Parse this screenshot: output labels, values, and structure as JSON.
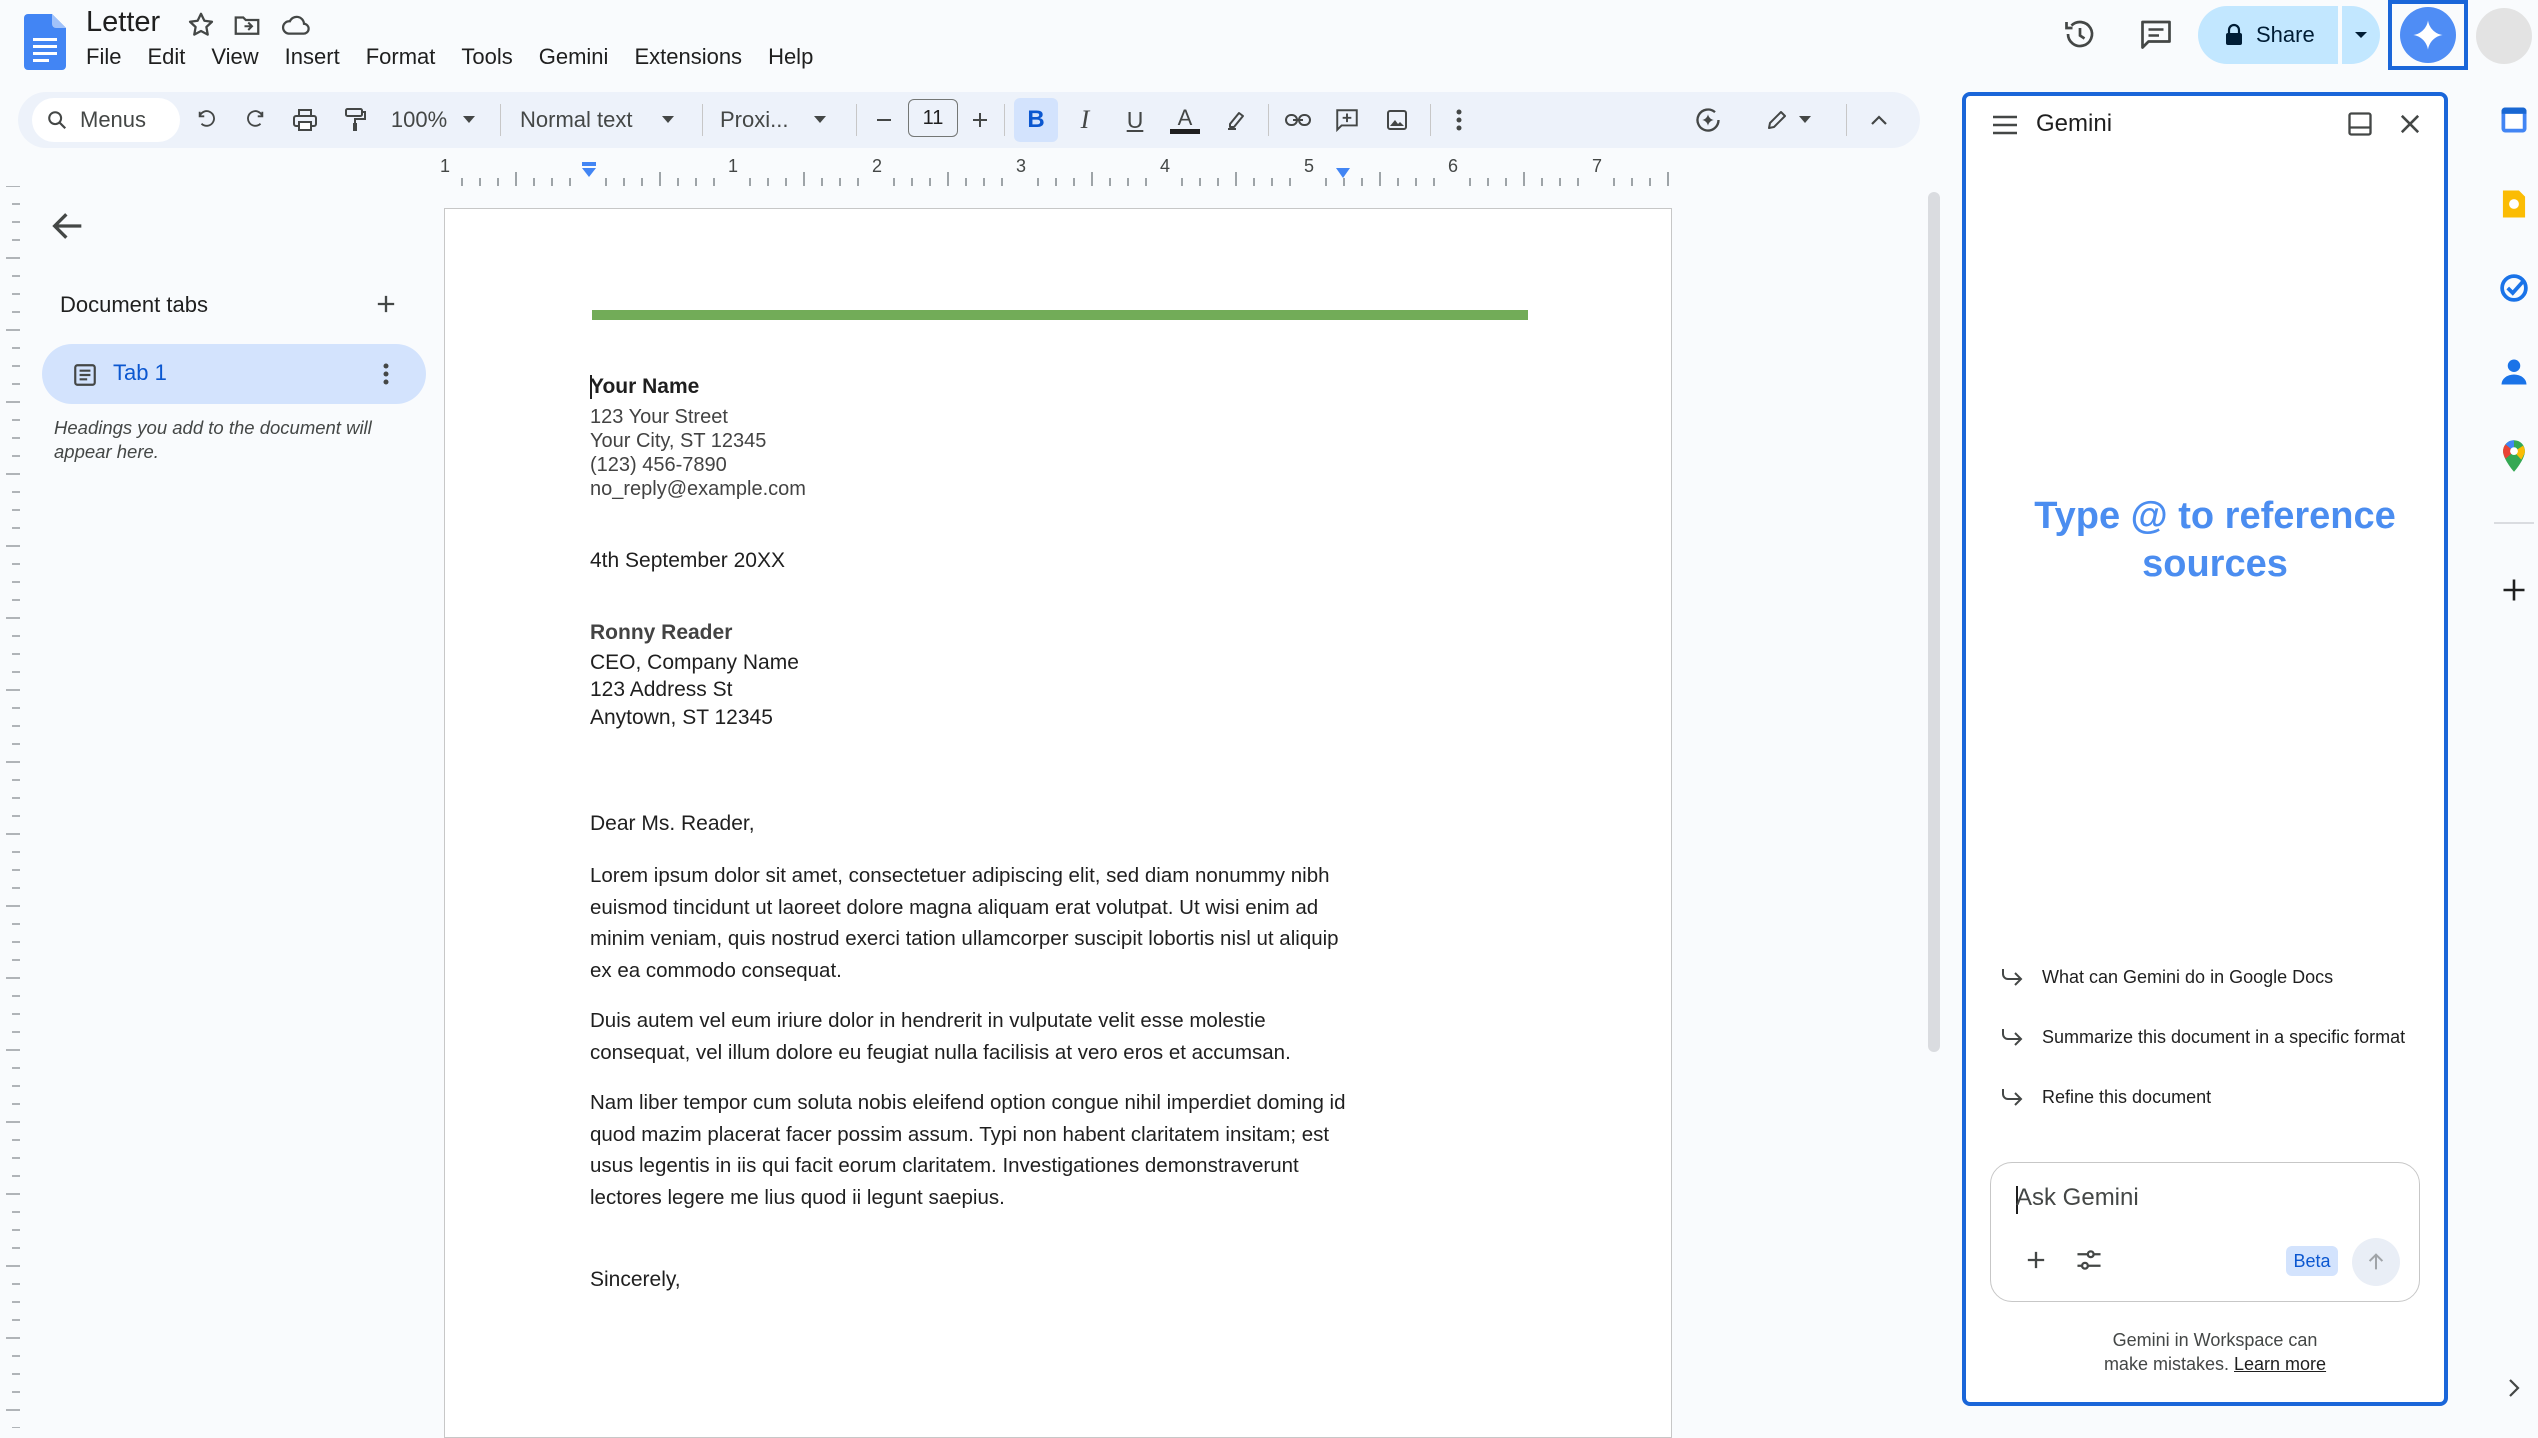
{
  "app": {
    "doc_title": "Letter"
  },
  "menubar": [
    "File",
    "Edit",
    "View",
    "Insert",
    "Format",
    "Tools",
    "Gemini",
    "Extensions",
    "Help"
  ],
  "header": {
    "share_label": "Share"
  },
  "toolbar": {
    "search_label": "Menus",
    "zoom": "100%",
    "style": "Normal text",
    "font": "Proxi...",
    "font_size": "11",
    "bold": "B",
    "italic": "I",
    "underline": "U",
    "text_color": "A"
  },
  "ruler": {
    "labels": [
      "1",
      "1",
      "2",
      "3",
      "4",
      "5",
      "6",
      "7"
    ]
  },
  "left_panel": {
    "title": "Document tabs",
    "tab_label": "Tab 1",
    "hint": "Headings you add to the document will appear here."
  },
  "document": {
    "sender_name": "Your Name",
    "sender_street": "123 Your Street",
    "sender_city": "Your City, ST 12345",
    "sender_phone": "(123) 456-7890",
    "sender_email": "no_reply@example.com",
    "date": "4th September 20XX",
    "recipient_name": "Ronny Reader",
    "recipient_title": "CEO, Company Name",
    "recipient_street": "123 Address St",
    "recipient_city": "Anytown, ST 12345",
    "salutation": "Dear Ms. Reader,",
    "paragraph1": "Lorem ipsum dolor sit amet, consectetuer adipiscing elit, sed diam nonummy nibh euismod tincidunt ut laoreet dolore magna aliquam erat volutpat. Ut wisi enim ad minim veniam, quis nostrud exerci tation ullamcorper suscipit lobortis nisl ut aliquip ex ea commodo consequat.",
    "paragraph2": "Duis autem vel eum iriure dolor in hendrerit in vulputate velit esse molestie consequat, vel illum dolore eu feugiat nulla facilisis at vero eros et accumsan.",
    "paragraph3": "Nam liber tempor cum soluta nobis eleifend option congue nihil imperdiet doming id quod mazim placerat facer possim assum. Typi non habent claritatem insitam; est usus legentis in iis qui facit eorum claritatem. Investigationes demonstraverunt lectores legere me lius quod ii legunt saepius.",
    "closing": "Sincerely,"
  },
  "gemini": {
    "title": "Gemini",
    "hero_line1": "Type @ to reference",
    "hero_line2": "sources",
    "suggestions": [
      "What can Gemini do in Google Docs",
      "Summarize this document in a specific format",
      "Refine this document"
    ],
    "input_placeholder": "Ask Gemini",
    "beta": "Beta",
    "disclaimer_line1": "Gemini in Workspace can",
    "disclaimer_line2": "make mistakes.",
    "learn_more": "Learn more"
  },
  "colors": {
    "accent": "#0b57d0",
    "highlight_border": "#1a66d9",
    "tab_selected": "#d3e3fd",
    "green_rule": "#6aa84f",
    "gemini_hero": "#4b8df0"
  }
}
